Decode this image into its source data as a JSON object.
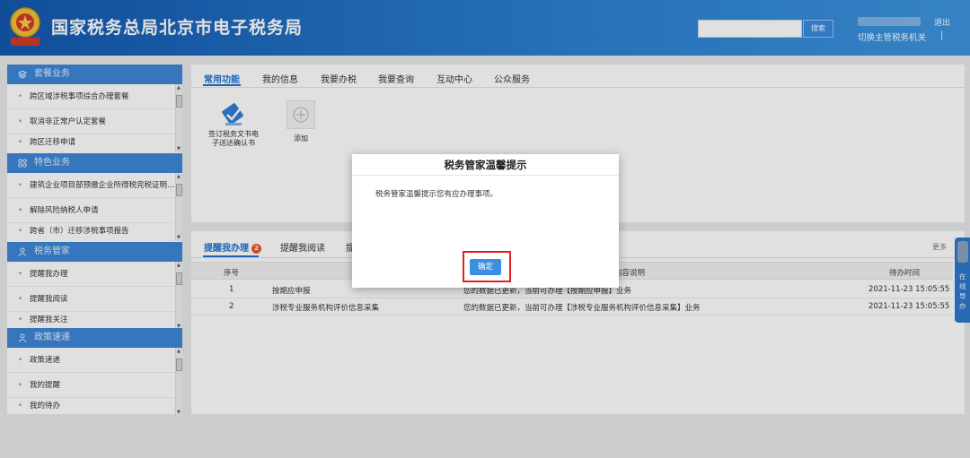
{
  "header": {
    "site_title": "国家税务总局北京市电子税务局",
    "search_button": "搜索",
    "logout": "退出",
    "switch_office": "切换主管税务机关",
    "divider": "|"
  },
  "sidebar": {
    "sections": [
      {
        "title": "套餐业务",
        "items": [
          "跨区域涉税事项综合办理套餐",
          "取消非正常户认定套餐",
          "跨区迁移申请"
        ]
      },
      {
        "title": "特色业务",
        "items": [
          "建筑企业项目部预缴企业所得税完税证明...",
          "解除风险纳税人申请",
          "跨省（市）迁移涉税事项报告"
        ]
      },
      {
        "title": "税务管家",
        "items": [
          "提醒我办理",
          "提醒我阅读",
          "提醒我关注"
        ]
      },
      {
        "title": "政策速递",
        "items": [
          "政策速递",
          "我的提醒",
          "我的待办"
        ]
      }
    ]
  },
  "func_panel": {
    "tabs": [
      "常用功能",
      "我的信息",
      "我要办税",
      "我要查询",
      "互动中心",
      "公众服务"
    ],
    "app_label": "签订税务文书电子送达确认书",
    "add_label": "添加"
  },
  "remind_panel": {
    "tabs": [
      "提醒我办理",
      "提醒我阅读",
      "提"
    ],
    "badge": "2",
    "more": "更多",
    "columns": [
      "序号",
      "内容说明",
      "待办时间"
    ],
    "rows": [
      {
        "no": "1",
        "name": "按期应申报",
        "desc": "您的数据已更新，当前可办理【按期应申报】业务",
        "time": "2021-11-23 15:05:55"
      },
      {
        "no": "2",
        "name": "涉税专业服务机构评价信息采集",
        "desc": "您的数据已更新，当前可办理【涉税专业服务机构评价信息采集】业务",
        "time": "2021-11-23 15:05:55"
      }
    ]
  },
  "online_widget": {
    "text": "在线导办"
  },
  "modal": {
    "title": "税务管家温馨提示",
    "message": "税务管家温馨提示您有应办理事项。",
    "confirm": "确定"
  },
  "colors": {
    "header_blue": "#1459b0",
    "sidebar_head": "#3e87d8",
    "accent": "#1f74d2",
    "highlight_red": "#e02020"
  }
}
